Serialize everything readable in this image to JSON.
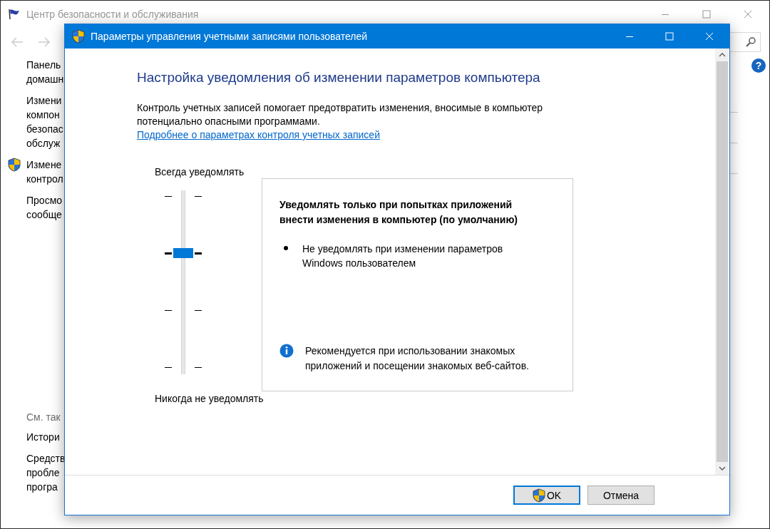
{
  "background_window": {
    "title": "Центр безопасности и обслуживания",
    "sidebar": [
      {
        "kind": "plain",
        "text": "Панель\nдомашн"
      },
      {
        "kind": "plain",
        "text": "Измени\nкомпон\nбезопас\nобслуж"
      },
      {
        "kind": "shield",
        "text": "Измене\nконтрол"
      },
      {
        "kind": "plain",
        "text": "Просмо\nсообще"
      }
    ],
    "help_label": "?",
    "see_also_heading": "См. так",
    "see_also": [
      {
        "text": "Истори"
      },
      {
        "text": "Средств\nпробле\nпрогра"
      }
    ]
  },
  "dialog": {
    "title": "Параметры управления учетными записями пользователей",
    "heading": "Настройка уведомления об изменении параметров компьютера",
    "description": "Контроль учетных записей помогает предотвратить изменения, вносимые в компьютер потенциально опасными программами.",
    "link": "Подробнее о параметрах контроля учетных записей",
    "slider": {
      "top_label": "Всегда уведомлять",
      "bottom_label": "Никогда не уведомлять",
      "level": 0.667
    },
    "setting": {
      "title": "Уведомлять только при попытках приложений внести изменения в компьютер (по умолчанию)",
      "bullets": [
        "Не уведомлять при изменении параметров Windows пользователем"
      ],
      "note": "Рекомендуется при использовании знакомых приложений и посещении знакомых веб-сайтов."
    },
    "buttons": [
      {
        "label": "OK",
        "kind": "shield",
        "default": true
      },
      {
        "label": "Отмена",
        "kind": "plain",
        "default": false
      }
    ]
  }
}
